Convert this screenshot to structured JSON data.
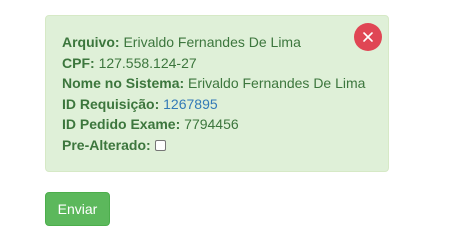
{
  "panel": {
    "fields": [
      {
        "label": "Arquivo:",
        "value": "Erivaldo Fernandes De Lima"
      },
      {
        "label": "CPF:",
        "value": "127.558.124-27"
      },
      {
        "label": "Nome no Sistema:",
        "value": "Erivaldo Fernandes De Lima"
      },
      {
        "label": "ID Requisição:",
        "value": "1267895"
      },
      {
        "label": "ID Pedido Exame:",
        "value": "7794456"
      },
      {
        "label": "Pre-Alterado:",
        "checked": false
      }
    ],
    "close_icon": "close-icon"
  },
  "actions": {
    "send_label": "Enviar"
  },
  "colors": {
    "panel_bg": "#dff0d8",
    "panel_text": "#3c763d",
    "link": "#337ab7",
    "close_bg": "#e04654",
    "send_bg": "#5cb85c"
  }
}
